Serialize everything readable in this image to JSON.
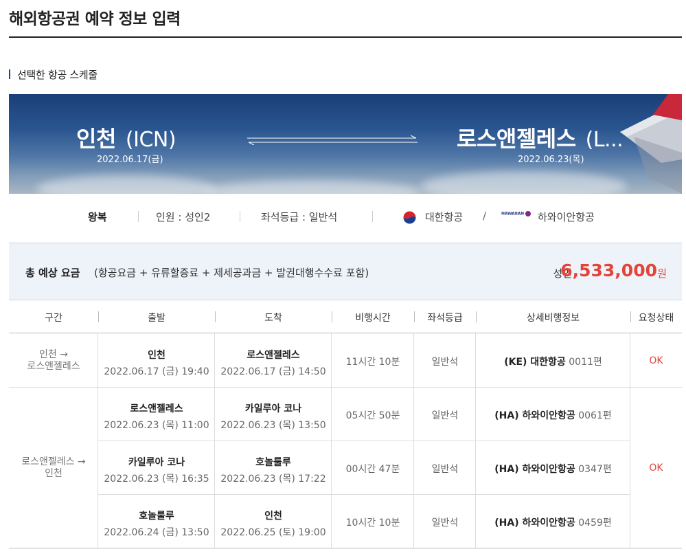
{
  "page_title": "해외항공권 예약 정보 입력",
  "section_title": "선택한 항공 스케줄",
  "banner": {
    "origin_city": "인천",
    "origin_code": "(ICN)",
    "origin_date": "2022.06.17(금)",
    "dest_city": "로스앤젤레스",
    "dest_code": "(L...",
    "dest_date": "2022.06.23(목)"
  },
  "summary": {
    "trip_type": "왕복",
    "passengers": "인원 : 성인2",
    "seat_class": "좌석등급 : 일반석",
    "airline1": "대한항공",
    "divider": "/",
    "airline2_logo_text": "HAWAIIAN",
    "airline2": "하와이안항공"
  },
  "fare": {
    "title": "총 예상 요금",
    "subtitle": "(항공요금 + 유류할증료 + 제세공과금 + 발권대행수수료 포함)",
    "passenger_type": "성인",
    "amount": "6,533,000",
    "unit": "원"
  },
  "table": {
    "headers": [
      "구간",
      "출발",
      "도착",
      "비행시간",
      "좌석등급",
      "상세비행정보",
      "요청상태"
    ],
    "groups": [
      {
        "segment_line1": "인천 →",
        "segment_line2": "로스앤젤레스",
        "status": "OK",
        "flights": [
          {
            "dep_place": "인천",
            "dep_time": "2022.06.17 (금) 19:40",
            "arr_place": "로스앤젤레스",
            "arr_time": "2022.06.17 (금) 14:50",
            "duration": "11시간 10분",
            "class": "일반석",
            "carrier": "(KE) 대한항공",
            "flight_no": "0011편"
          }
        ]
      },
      {
        "segment_line1": "로스앤젤레스 →",
        "segment_line2": "인천",
        "status": "OK",
        "flights": [
          {
            "dep_place": "로스앤젤레스",
            "dep_time": "2022.06.23 (목) 11:00",
            "arr_place": "카일루아 코나",
            "arr_time": "2022.06.23 (목) 13:50",
            "duration": "05시간 50분",
            "class": "일반석",
            "carrier": "(HA) 하와이안항공",
            "flight_no": "0061편"
          },
          {
            "dep_place": "카일루아 코나",
            "dep_time": "2022.06.23 (목) 16:35",
            "arr_place": "호놀룰루",
            "arr_time": "2022.06.23 (목) 17:22",
            "duration": "00시간 47분",
            "class": "일반석",
            "carrier": "(HA) 하와이안항공",
            "flight_no": "0347편"
          },
          {
            "dep_place": "호놀룰루",
            "dep_time": "2022.06.24 (금) 13:50",
            "arr_place": "인천",
            "arr_time": "2022.06.25 (토) 19:00",
            "duration": "10시간 10분",
            "class": "일반석",
            "carrier": "(HA) 하와이안항공",
            "flight_no": "0459편"
          }
        ]
      }
    ]
  }
}
